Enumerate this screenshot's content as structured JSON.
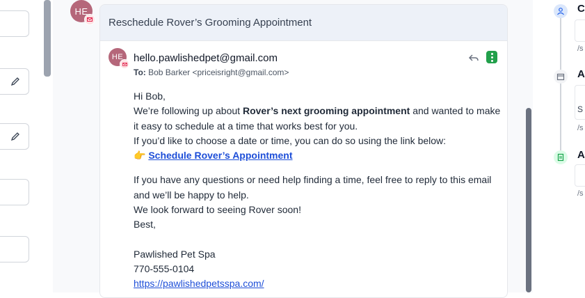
{
  "email": {
    "subject": "Reschedule Rover’s Grooming Appointment",
    "avatar_initials": "HE",
    "from": "hello.pawlishedpet@gmail.com",
    "to_label": "To:",
    "to": "Bob Barker <priceisright@gmail.com>",
    "greeting": "Hi Bob,",
    "line1_pre": "We’re following up about ",
    "line1_bold": "Rover’s next grooming appointment",
    "line1_post": " and wanted to make it easy to schedule at a time that works best for you.",
    "line2": "If you’d like to choose a date or time, you can do so using the link below:",
    "pointer_emoji": "👉",
    "link_text": "Schedule Rover’s Appointment",
    "line3": "If you have any questions or need help finding a time, feel free to reply to this email and we’ll be happy to help.",
    "line4": "We look forward to seeing Rover soon!",
    "signoff": "Best,",
    "sig_name": "Pawlished Pet Spa",
    "sig_phone": "770-555-0104",
    "sig_url": "https://pawlishedpetsspa.com/"
  },
  "timeline": {
    "items": [
      {
        "letter": "C",
        "path": "/s",
        "icon": "person-icon",
        "color": "#dbe7fb"
      },
      {
        "letter": "A",
        "sub": "S",
        "path": "/s",
        "icon": "calendar-icon",
        "color": "#f3f4f6"
      },
      {
        "letter": "A",
        "path": "/s",
        "icon": "document-icon",
        "color": "#dcfce7"
      }
    ]
  },
  "icons": {
    "reply": "reply-icon",
    "menu": "more-options-icon",
    "edit": "pencil-icon",
    "mail_badge": "mail-icon"
  }
}
